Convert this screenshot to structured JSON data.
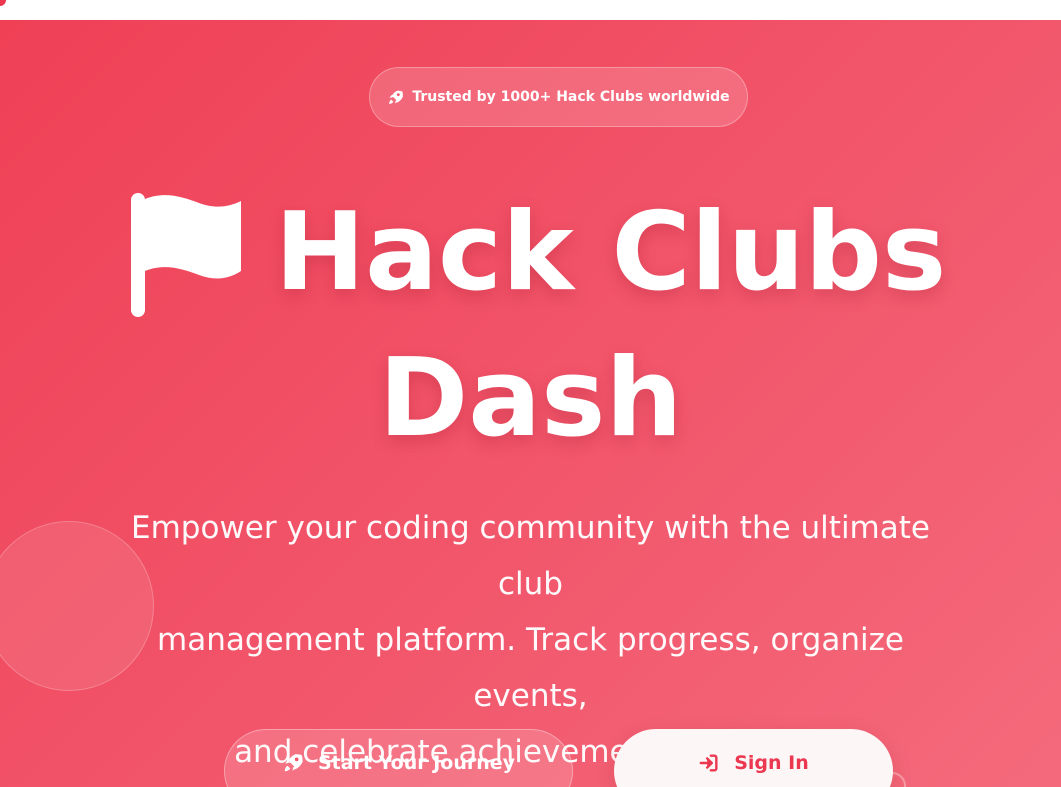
{
  "badge": {
    "icon": "rocket-icon",
    "text": "Trusted by 1000+ Hack Clubs worldwide"
  },
  "hero": {
    "title_icon": "flag-icon",
    "title_line1": "Hack Clubs",
    "title_line2": "Dash",
    "subtitle_lines": [
      "Empower your coding community with the ultimate club",
      "management platform. Track progress, organize events,",
      "and celebrate achievements together."
    ]
  },
  "actions": {
    "primary": {
      "icon": "rocket-icon",
      "label": "Start Your Journey"
    },
    "secondary": {
      "icon": "sign-in-icon",
      "label": "Sign In"
    }
  },
  "colors": {
    "brand": "#ec3750",
    "gradient_start": "#ef4056",
    "gradient_end": "#f46a7c",
    "text_on_brand": "#ffffff",
    "secondary_button_bg": "#fdf6f6"
  }
}
